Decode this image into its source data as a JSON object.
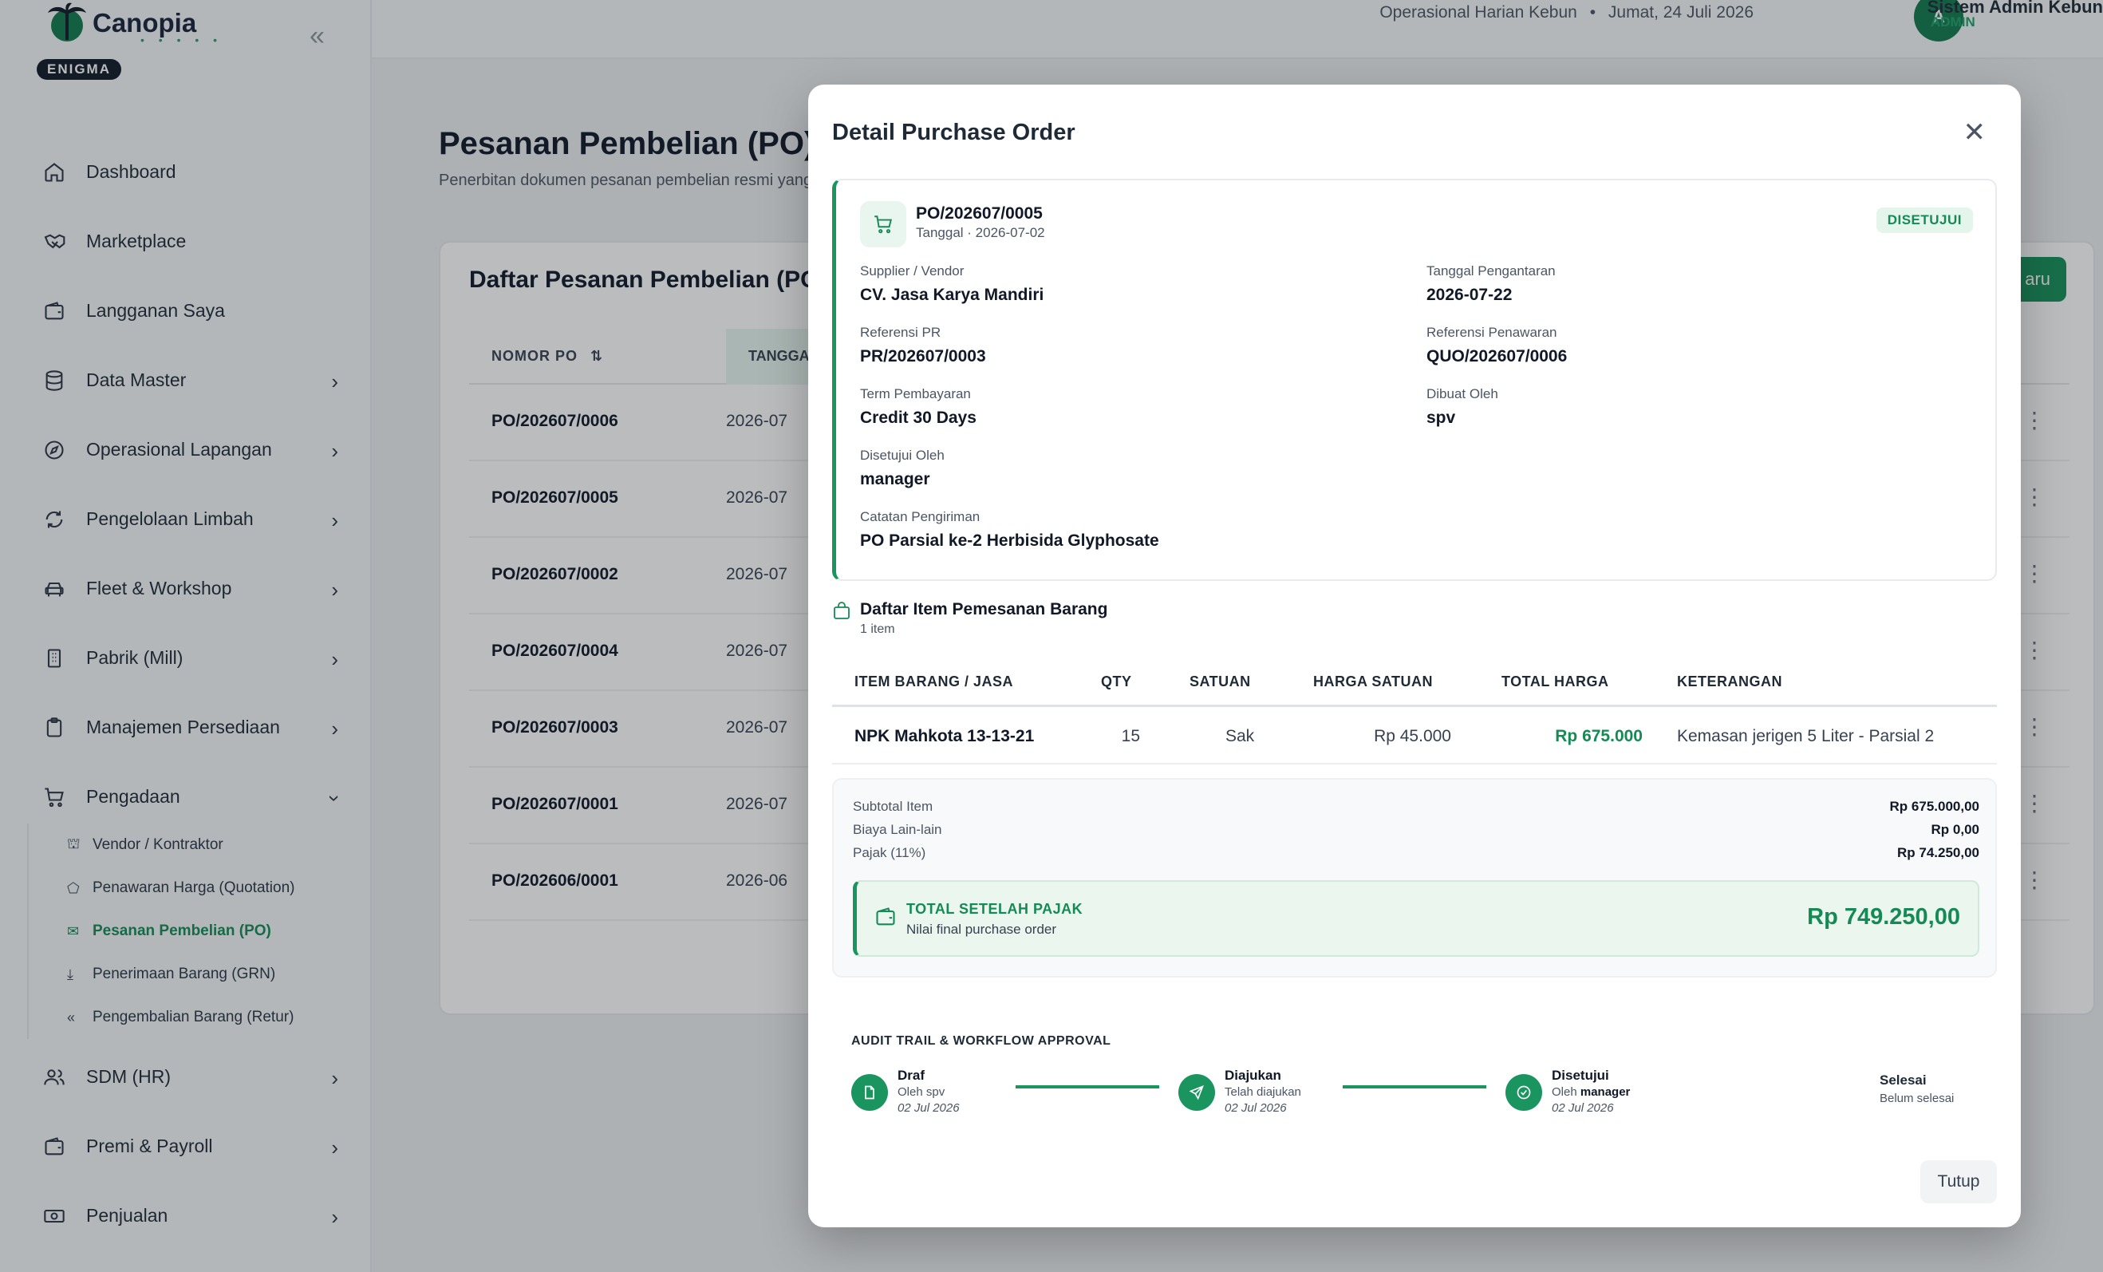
{
  "brand": {
    "name": "Canopia",
    "dots": "• • • • •",
    "badge": "ENIGMA"
  },
  "sidebar": {
    "items": [
      {
        "label": "Dashboard"
      },
      {
        "label": "Marketplace"
      },
      {
        "label": "Langganan Saya"
      },
      {
        "label": "Data Master"
      },
      {
        "label": "Operasional Lapangan"
      },
      {
        "label": "Pengelolaan Limbah"
      },
      {
        "label": "Fleet & Workshop"
      },
      {
        "label": "Pabrik (Mill)"
      },
      {
        "label": "Manajemen Persediaan"
      },
      {
        "label": "Pengadaan"
      }
    ],
    "sub_items": [
      {
        "label": "Vendor / Kontraktor"
      },
      {
        "label": "Penawaran Harga (Quotation)"
      },
      {
        "label": "Pesanan Pembelian (PO)"
      },
      {
        "label": "Penerimaan Barang (GRN)"
      },
      {
        "label": "Pengembalian Barang (Retur)"
      }
    ],
    "items_after": [
      {
        "label": "SDM (HR)"
      },
      {
        "label": "Premi & Payroll"
      },
      {
        "label": "Penjualan"
      }
    ]
  },
  "header": {
    "context": "Operasional Harian Kebun",
    "separator": "•",
    "date": "Jumat, 24 Juli 2026",
    "avatar_initial": "A",
    "user_name": "Sistem Admin Kebun",
    "user_role": "ADMIN"
  },
  "page": {
    "title": "Pesanan Pembelian (PO)",
    "description": "Penerbitan dokumen pesanan pembelian resmi yang",
    "card_title": "Daftar Pesanan Pembelian (PO)",
    "new_button": "aru",
    "columns": [
      "NOMOR PO",
      "TANGGA"
    ],
    "rows": [
      {
        "po": "PO/202607/0006",
        "date": "2026-07"
      },
      {
        "po": "PO/202607/0005",
        "date": "2026-07"
      },
      {
        "po": "PO/202607/0002",
        "date": "2026-07"
      },
      {
        "po": "PO/202607/0004",
        "date": "2026-07"
      },
      {
        "po": "PO/202607/0003",
        "date": "2026-07"
      },
      {
        "po": "PO/202607/0001",
        "date": "2026-07"
      },
      {
        "po": "PO/202606/0001",
        "date": "2026-06"
      }
    ]
  },
  "modal": {
    "title": "Detail Purchase Order",
    "po_number": "PO/202607/0005",
    "po_date": "Tanggal · 2026-07-02",
    "status": "DISETUJUI",
    "fields": {
      "supplier_label": "Supplier / Vendor",
      "supplier": "CV. Jasa Karya Mandiri",
      "delivery_label": "Tanggal Pengantaran",
      "delivery": "2026-07-22",
      "pr_label": "Referensi PR",
      "pr": "PR/202607/0003",
      "quote_label": "Referensi Penawaran",
      "quote": "QUO/202607/0006",
      "term_label": "Term Pembayaran",
      "term": "Credit 30 Days",
      "creator_label": "Dibuat Oleh",
      "creator": "spv",
      "approver_label": "Disetujui Oleh",
      "approver": "manager",
      "note_label": "Catatan Pengiriman",
      "note": "PO Parsial ke-2 Herbisida Glyphosate"
    },
    "items_title": "Daftar Item Pemesanan Barang",
    "items_count": "1 item",
    "columns": [
      "ITEM BARANG / JASA",
      "QTY",
      "SATUAN",
      "HARGA SATUAN",
      "TOTAL HARGA",
      "KETERANGAN"
    ],
    "items": [
      {
        "name": "NPK Mahkota 13-13-21",
        "qty": "15",
        "unit": "Sak",
        "price": "Rp 45.000",
        "total": "Rp 675.000",
        "note": "Kemasan jerigen 5 Liter - Parsial 2"
      }
    ],
    "summary": {
      "subtotal_label": "Subtotal Item",
      "subtotal": "Rp 675.000,00",
      "other_label": "Biaya Lain-lain",
      "other": "Rp 0,00",
      "tax_label": "Pajak (11%)",
      "tax": "Rp 74.250,00",
      "total_label": "TOTAL SETELAH PAJAK",
      "total_sub": "Nilai final purchase order",
      "total": "Rp 749.250,00"
    },
    "audit_title": "AUDIT TRAIL & WORKFLOW APPROVAL",
    "steps": [
      {
        "title": "Draf",
        "by": "Oleh spv",
        "date": "02 Jul 2026"
      },
      {
        "title": "Diajukan",
        "by": "Telah diajukan",
        "date": "02 Jul 2026"
      },
      {
        "title": "Disetujui",
        "by_prefix": "Oleh ",
        "by_name": "manager",
        "date": "02 Jul 2026"
      }
    ],
    "final_step": {
      "title": "Selesai",
      "sub": "Belum selesai"
    },
    "close_button": "Tutup"
  },
  "colors": {
    "accent": "#168a55",
    "accent_dark": "#127a4c",
    "accent_light": "#e9f6ef"
  }
}
